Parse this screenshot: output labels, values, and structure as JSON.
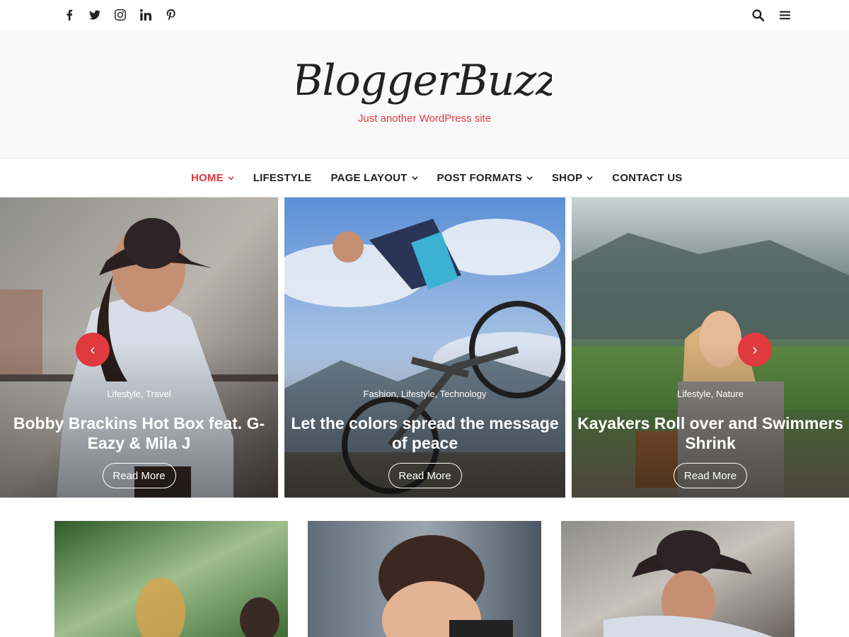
{
  "colors": {
    "accent": "#e0393e",
    "text": "#222222",
    "header_bg": "#f9f9f9"
  },
  "topbar": {
    "social": [
      {
        "icon": "facebook-icon"
      },
      {
        "icon": "twitter-icon"
      },
      {
        "icon": "instagram-icon"
      },
      {
        "icon": "linkedin-icon"
      },
      {
        "icon": "pinterest-icon"
      }
    ],
    "right": [
      {
        "icon": "search-icon"
      },
      {
        "icon": "menu-icon"
      }
    ]
  },
  "header": {
    "site_title": "BloggerBuzz",
    "tagline": "Just another WordPress site"
  },
  "nav": {
    "items": [
      {
        "label": "HOME",
        "active": true,
        "has_dropdown": true
      },
      {
        "label": "LIFESTYLE",
        "active": false,
        "has_dropdown": false
      },
      {
        "label": "PAGE LAYOUT",
        "active": false,
        "has_dropdown": true
      },
      {
        "label": "POST FORMATS",
        "active": false,
        "has_dropdown": true
      },
      {
        "label": "SHOP",
        "active": false,
        "has_dropdown": true
      },
      {
        "label": "CONTACT US",
        "active": false,
        "has_dropdown": false
      }
    ]
  },
  "slider": {
    "prev_label": "‹",
    "next_label": "›",
    "slides": [
      {
        "categories": "Lifestyle, Travel",
        "title": "Bobby Brackins Hot Box feat. G-Eazy & Mila J",
        "button": "Read More"
      },
      {
        "categories": "Fashion, Lifestyle, Technology",
        "title": "Let the colors spread the message of peace",
        "button": "Read More"
      },
      {
        "categories": "Lifestyle, Nature",
        "title": "Kayakers Roll over and Swimmers Shrink",
        "button": "Read More"
      }
    ]
  }
}
